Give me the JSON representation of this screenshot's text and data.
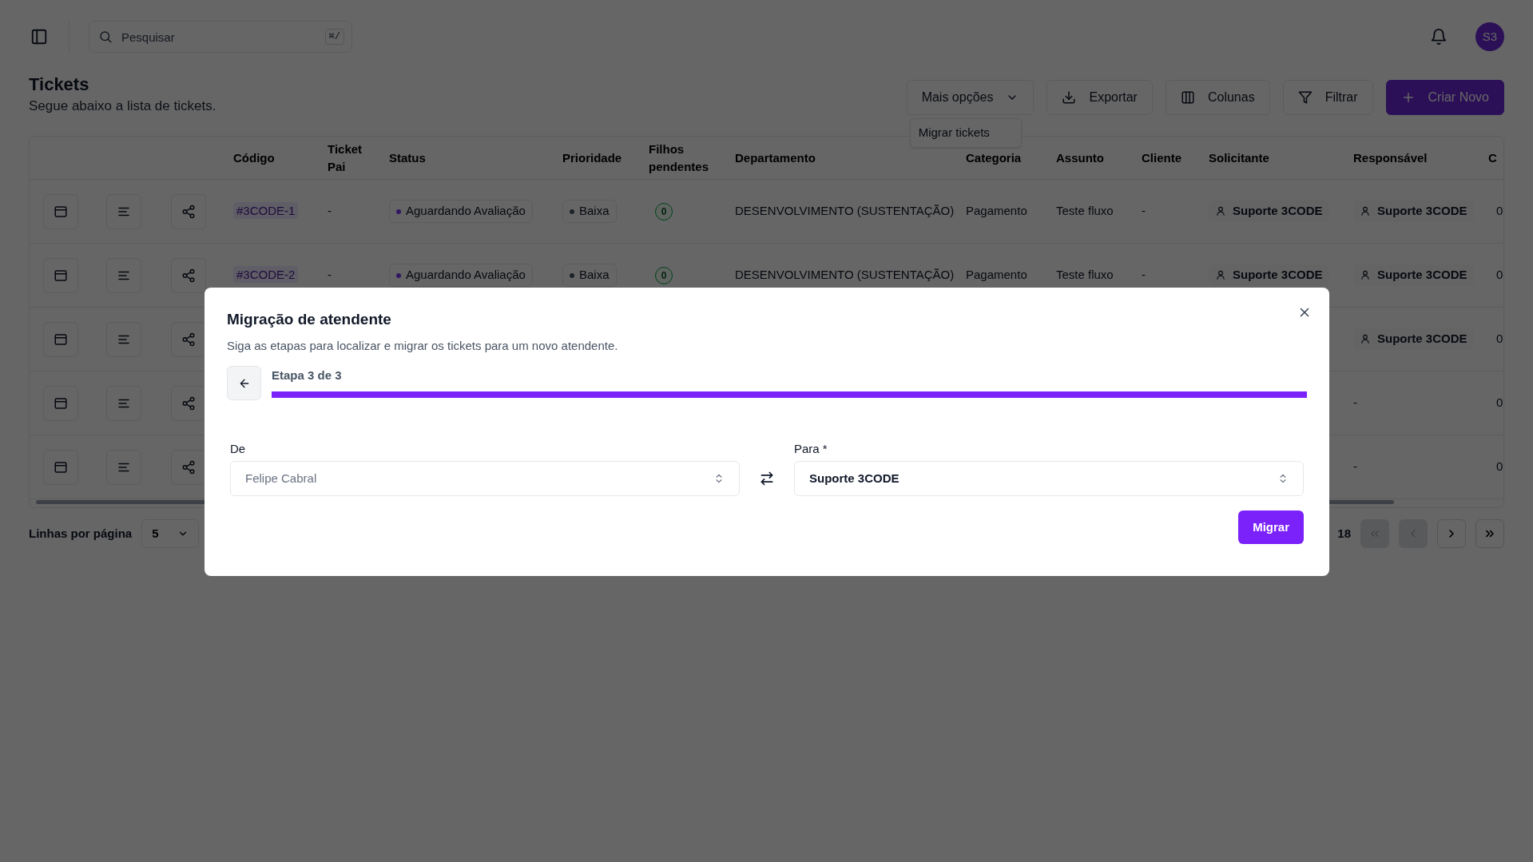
{
  "topbar": {
    "search": {
      "placeholder": "Pesquisar",
      "shortcut": "⌘/"
    },
    "avatar": "S3"
  },
  "page": {
    "title": "Tickets",
    "subtitle": "Segue abaixo a lista de tickets."
  },
  "toolbar": {
    "buttons": [
      {
        "label": "Mais opções",
        "kind": "dropdown"
      },
      {
        "label": "Exportar",
        "kind": "export"
      },
      {
        "label": "Colunas",
        "kind": "columns"
      },
      {
        "label": "Filtrar",
        "kind": "filter"
      },
      {
        "label": "Criar Novo",
        "kind": "create"
      }
    ],
    "menu": {
      "items": [
        "Migrar tickets"
      ]
    }
  },
  "table": {
    "columns": [
      "Código",
      "Ticket Pai",
      "Status",
      "Prioridade",
      "Filhos pendentes",
      "Departamento",
      "Categoria",
      "Assunto",
      "Cliente",
      "Solicitante",
      "Responsável",
      "C"
    ],
    "rows": [
      {
        "codigo": "#3CODE-1",
        "ticket_pai": "-",
        "status": "Aguardando Avaliação",
        "prioridade": "Baixa",
        "filhos": "0",
        "departamento": "DESENVOLVIMENTO (SUSTENTAÇÃO)",
        "categoria": "Pagamento",
        "assunto": "Teste fluxo",
        "cliente": "-",
        "solicitante": {
          "kind": "user",
          "text": "Suporte 3CODE"
        },
        "responsavel": {
          "kind": "user",
          "text": "Suporte 3CODE"
        },
        "column_13": "0"
      },
      {
        "codigo": "#3CODE-2",
        "ticket_pai": "-",
        "status": "Aguardando Avaliação",
        "prioridade": "Baixa",
        "filhos": "0",
        "departamento": "DESENVOLVIMENTO (SUSTENTAÇÃO)",
        "categoria": "Pagamento",
        "assunto": "Teste fluxo",
        "cliente": "-",
        "solicitante": {
          "kind": "user",
          "text": "Suporte 3CODE"
        },
        "responsavel": {
          "kind": "user",
          "text": "Suporte 3CODE"
        },
        "column_13": "0"
      },
      {
        "responsavel": {
          "kind": "user",
          "text": "Suporte 3CODE"
        },
        "column_13": "0"
      },
      {
        "responsavel": {
          "kind": "none",
          "text": "-"
        },
        "column_13": "0"
      },
      {
        "responsavel": {
          "kind": "none",
          "text": "-"
        },
        "column_13": "0"
      }
    ]
  },
  "pagination": {
    "rows_per_page": {
      "label": "Linhas por página",
      "value": "5"
    },
    "page_info": "18",
    "nav": [
      {
        "kind": "first",
        "disabled": true
      },
      {
        "kind": "prev",
        "disabled": true
      },
      {
        "kind": "next",
        "disabled": false
      },
      {
        "kind": "last",
        "disabled": false
      }
    ]
  },
  "modal": {
    "title": "Migração de atendente",
    "description": "Siga as etapas para localizar e migrar os tickets para um novo atendente.",
    "progress": {
      "label": "Etapa 3 de 3",
      "level": 1
    },
    "from": {
      "label": "De",
      "value": "Felipe Cabral",
      "disabled": true
    },
    "to": {
      "label": "Para *",
      "value": "Suporte 3CODE",
      "disabled": false
    },
    "submit": "Migrar"
  }
}
